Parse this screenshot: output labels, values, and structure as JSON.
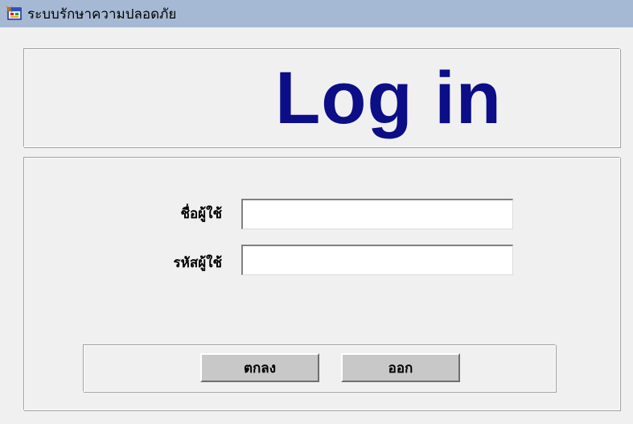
{
  "window": {
    "title": "ระบบรักษาความปลอดภัย",
    "icon": "app-window-icon"
  },
  "header": {
    "heading": "Log in",
    "heading_color": "#0b0e86"
  },
  "form": {
    "username_label": "ชื่อผู้ใช้",
    "username_value": "",
    "password_label": "รหัสผู้ใช้",
    "password_value": ""
  },
  "buttons": {
    "ok_label": "ตกลง",
    "exit_label": "ออก"
  },
  "colors": {
    "titlebar": "#a6b9d4",
    "background": "#f0f0f0",
    "button_face": "#c8c8c8"
  }
}
